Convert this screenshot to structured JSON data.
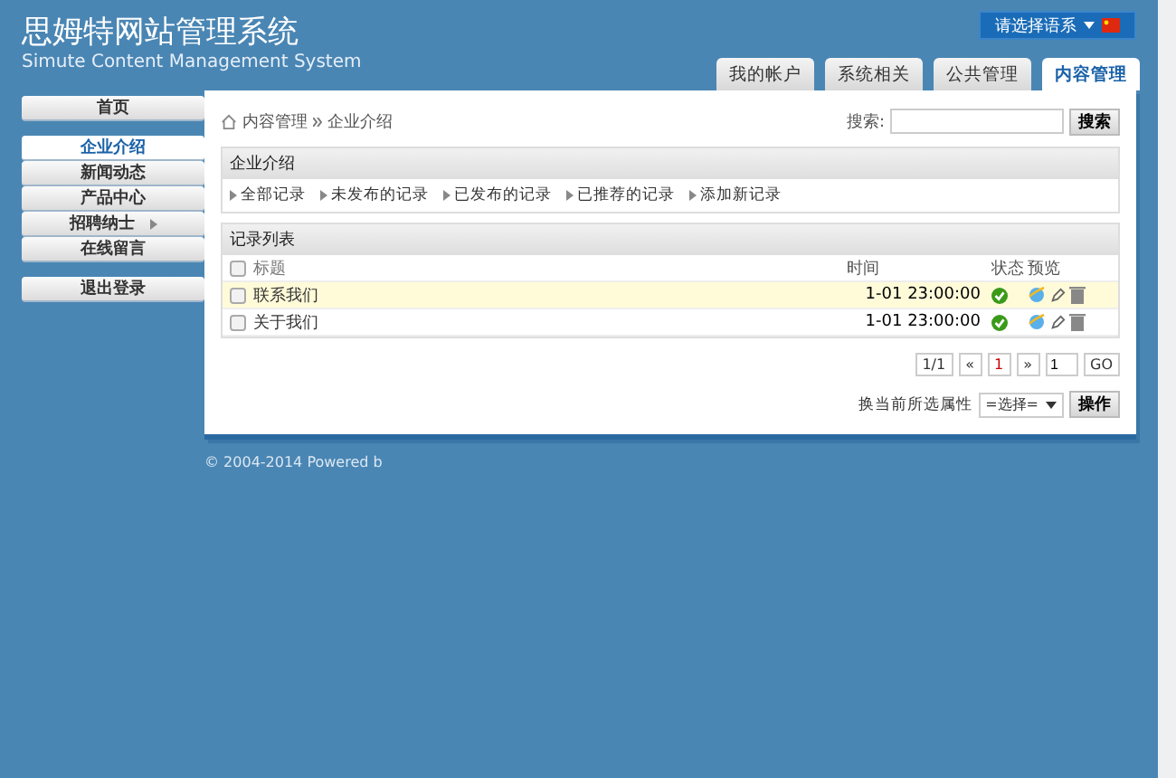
{
  "header": {
    "title": "思姆特网站管理系统",
    "subtitle": "Simute Content Management System",
    "language_button": "请选择语系"
  },
  "tabs": [
    {
      "label": "我的帐户",
      "selected": false
    },
    {
      "label": "系统相关",
      "selected": false
    },
    {
      "label": "公共管理",
      "selected": false
    },
    {
      "label": "内容管理",
      "selected": true
    }
  ],
  "sidebar": {
    "groups": [
      {
        "items": [
          {
            "label": "首页",
            "selected": false,
            "has_arrow": false
          }
        ]
      },
      {
        "items": [
          {
            "label": "企业介绍",
            "selected": true,
            "has_arrow": false
          },
          {
            "label": "新闻动态",
            "selected": false,
            "has_arrow": false
          },
          {
            "label": "产品中心",
            "selected": false,
            "has_arrow": false
          },
          {
            "label": "招聘纳士",
            "selected": false,
            "has_arrow": true
          },
          {
            "label": "在线留言",
            "selected": false,
            "has_arrow": false
          }
        ]
      },
      {
        "items": [
          {
            "label": "退出登录",
            "selected": false,
            "has_arrow": false
          }
        ]
      }
    ]
  },
  "breadcrumb": [
    "内容管理",
    "企业介绍"
  ],
  "search": {
    "label": "搜索:",
    "button": "搜索"
  },
  "section": {
    "title": "企业介绍",
    "links": [
      "全部记录",
      "未发布的记录",
      "已发布的记录",
      "已推荐的记录",
      "添加新记录"
    ]
  },
  "records": {
    "title": "记录列表",
    "header_checked": false,
    "columns": [
      "标题",
      "时间",
      "状态",
      "预览"
    ],
    "rows": [
      {
        "title": "联系我们",
        "time": "1-01 23:00:00",
        "selected": true,
        "checked": false
      },
      {
        "title": "关于我们",
        "time": "1-01 23:00:00",
        "selected": false,
        "checked": false
      }
    ]
  },
  "pager": {
    "info": "1/1",
    "prev": "«",
    "current": "1",
    "next": "»",
    "page_input": "1",
    "go": "GO"
  },
  "action": {
    "label": "换当前所选属性",
    "select": "=选择=",
    "button": "操作"
  },
  "footer": "© 2004-2014 Powered b"
}
